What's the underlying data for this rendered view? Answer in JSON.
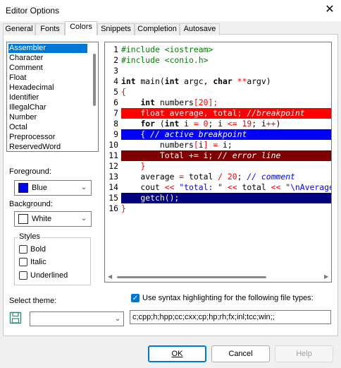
{
  "window": {
    "title": "Editor Options",
    "close_glyph": "✕"
  },
  "tabs": [
    {
      "label": "General"
    },
    {
      "label": "Fonts"
    },
    {
      "label": "Colors"
    },
    {
      "label": "Snippets"
    },
    {
      "label": "Completion"
    },
    {
      "label": "Autosave"
    }
  ],
  "active_tab": "Colors",
  "element_list": {
    "items": [
      "Assembler",
      "Character",
      "Comment",
      "Float",
      "Hexadecimal",
      "Identifier",
      "IllegalChar",
      "Number",
      "Octal",
      "Preprocessor",
      "ReservedWord"
    ],
    "selected": "Assembler"
  },
  "foreground": {
    "label": "Foreground:",
    "value": "Blue",
    "color": "#0000ff"
  },
  "background": {
    "label": "Background:",
    "value": "White",
    "color": "#ffffff"
  },
  "styles": {
    "legend": "Styles",
    "bold": {
      "label": "Bold",
      "checked": false
    },
    "italic": {
      "label": "Italic",
      "checked": false
    },
    "underlined": {
      "label": "Underlined",
      "checked": false
    }
  },
  "theme": {
    "label": "Select theme:",
    "value": "",
    "save_icon": "floppy-disk-icon"
  },
  "syntax_highlight": {
    "checked": true,
    "label": "Use syntax highlighting for the following file types:",
    "file_types": "c;cpp;h;hpp;cc;cxx;cp;hp;rh;fx;inl;tcc;win;;"
  },
  "buttons": {
    "ok": "OK",
    "cancel": "Cancel",
    "help": "Help"
  },
  "colors": {
    "preprocessor": "#008000",
    "keyword": "#000000",
    "number": "#ff0000",
    "comment": "#0000ff",
    "string": "#0000ff",
    "breakpoint_bg": "#ff0000",
    "active_breakpoint_bg": "#0000ff",
    "error_line_bg": "#800000",
    "current_line_bg": "#000080",
    "accent": "#0078d7"
  },
  "code_lines": [
    {
      "num": "1",
      "hl": "none",
      "parts": [
        [
          "#include <iostream>",
          "pre"
        ]
      ]
    },
    {
      "num": "2",
      "hl": "none",
      "parts": [
        [
          "#include <conio.h>",
          "pre"
        ]
      ]
    },
    {
      "num": "3",
      "hl": "none",
      "parts": []
    },
    {
      "num": "4",
      "hl": "none",
      "parts": [
        [
          "int",
          "kw"
        ],
        [
          " main(",
          "plain"
        ],
        [
          "int",
          "kw"
        ],
        [
          " argc, ",
          "plain"
        ],
        [
          "char",
          "kw"
        ],
        [
          " ",
          "plain"
        ],
        [
          "**",
          "op"
        ],
        [
          "argv)",
          "plain"
        ]
      ]
    },
    {
      "num": "5",
      "hl": "none",
      "parts": [
        [
          "{",
          "op"
        ]
      ]
    },
    {
      "num": "6",
      "hl": "none",
      "parts": [
        [
          "    ",
          "plain"
        ],
        [
          "int",
          "kw"
        ],
        [
          " numbers",
          "plain"
        ],
        [
          "[",
          "op"
        ],
        [
          "20",
          "num"
        ],
        [
          "];",
          "op"
        ]
      ]
    },
    {
      "num": "7",
      "hl": "break",
      "parts": [
        [
          "    ",
          "plain"
        ],
        [
          "float",
          "kw"
        ],
        [
          " average, total; ",
          "plain"
        ],
        [
          "//breakpoint",
          "cmt"
        ]
      ]
    },
    {
      "num": "8",
      "hl": "none",
      "parts": [
        [
          "    ",
          "plain"
        ],
        [
          "for",
          "kw"
        ],
        [
          " (",
          "plain"
        ],
        [
          "int",
          "kw"
        ],
        [
          " i ",
          "plain"
        ],
        [
          "=",
          "op"
        ],
        [
          " ",
          "plain"
        ],
        [
          "0",
          "num"
        ],
        [
          "; i ",
          "plain"
        ],
        [
          "<=",
          "op"
        ],
        [
          " ",
          "plain"
        ],
        [
          "19",
          "num"
        ],
        [
          "; i",
          "plain"
        ],
        [
          "++",
          "op"
        ],
        [
          ")",
          "plain"
        ]
      ]
    },
    {
      "num": "9",
      "hl": "active",
      "parts": [
        [
          "    { ",
          "plain"
        ],
        [
          "// active breakpoint",
          "cmt"
        ]
      ]
    },
    {
      "num": "10",
      "hl": "none",
      "parts": [
        [
          "        numbers",
          "plain"
        ],
        [
          "[",
          "op"
        ],
        [
          "i",
          "plain"
        ],
        [
          "]",
          "op"
        ],
        [
          " ",
          "plain"
        ],
        [
          "=",
          "op"
        ],
        [
          " i;",
          "plain"
        ]
      ]
    },
    {
      "num": "11",
      "hl": "error",
      "parts": [
        [
          "        Total ",
          "plain"
        ],
        [
          "+=",
          "op"
        ],
        [
          " i; ",
          "plain"
        ],
        [
          "// error line",
          "cmt"
        ]
      ]
    },
    {
      "num": "12",
      "hl": "none",
      "parts": [
        [
          "    ",
          "plain"
        ],
        [
          "}",
          "op"
        ]
      ]
    },
    {
      "num": "13",
      "hl": "none",
      "parts": [
        [
          "    average ",
          "plain"
        ],
        [
          "=",
          "op"
        ],
        [
          " total ",
          "plain"
        ],
        [
          "/",
          "op"
        ],
        [
          " ",
          "plain"
        ],
        [
          "20",
          "num"
        ],
        [
          "; ",
          "plain"
        ],
        [
          "// comment",
          "cmt"
        ]
      ]
    },
    {
      "num": "14",
      "hl": "none",
      "parts": [
        [
          "    cout ",
          "plain"
        ],
        [
          "<<",
          "op"
        ],
        [
          " ",
          "plain"
        ],
        [
          "\"total: \"",
          "str"
        ],
        [
          " ",
          "plain"
        ],
        [
          "<<",
          "op"
        ],
        [
          " total ",
          "plain"
        ],
        [
          "<<",
          "op"
        ],
        [
          " ",
          "plain"
        ],
        [
          "\"\\nAverage",
          "str"
        ]
      ]
    },
    {
      "num": "15",
      "hl": "current",
      "parts": [
        [
          "    getch();",
          "plain"
        ]
      ]
    },
    {
      "num": "16",
      "hl": "none",
      "parts": [
        [
          "}",
          "op"
        ]
      ]
    }
  ]
}
